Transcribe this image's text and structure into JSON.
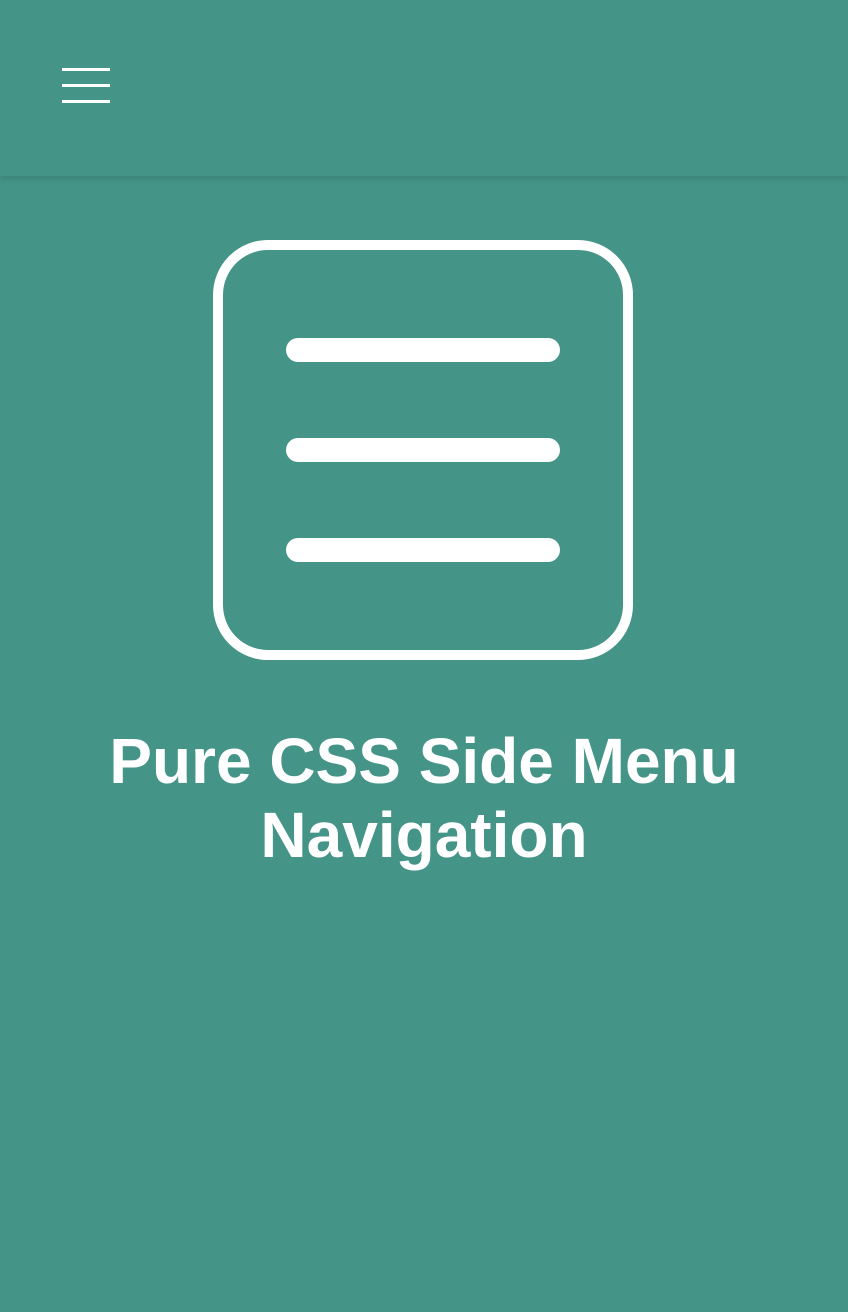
{
  "header": {
    "menu_icon": "hamburger-menu-icon"
  },
  "hero": {
    "logo_icon": "menu-list-icon",
    "title": "Pure CSS Side Menu Navigation"
  },
  "colors": {
    "background": "#449488",
    "foreground": "#ffffff"
  }
}
